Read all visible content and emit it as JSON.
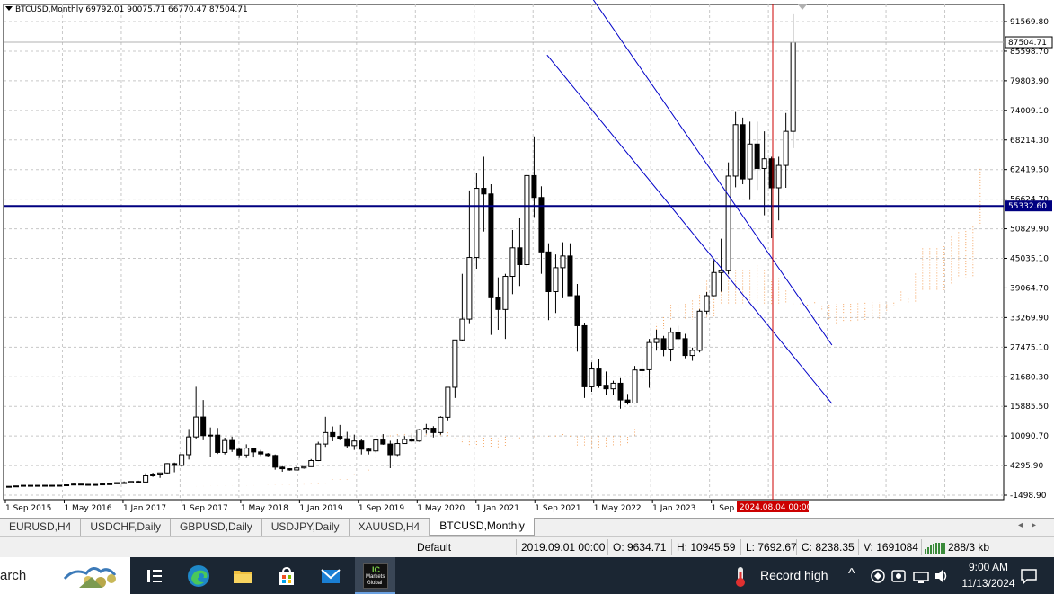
{
  "chart_header": "BTCUSD,Monthly  69792.01 90075.71 66770.47 87504.71",
  "price_labels": [
    "91569.80",
    "85598.70",
    "79803.90",
    "74009.10",
    "68214.30",
    "62419.50",
    "56624.70",
    "50829.90",
    "45035.10",
    "39064.70",
    "33269.90",
    "27475.10",
    "21680.30",
    "15885.50",
    "10090.70",
    "4295.90",
    "-1498.90"
  ],
  "current_price": "87504.71",
  "hline_price": "55332.60",
  "time_labels": [
    "1 Sep 2015",
    "1 May 2016",
    "1 Jan 2017",
    "1 Sep 2017",
    "1 May 2018",
    "1 Jan 2019",
    "1 Sep 2019",
    "1 May 2020",
    "1 Jan 2021",
    "1 Sep 2021",
    "1 May 2022",
    "1 Jan 2023",
    "1 Sep 2023"
  ],
  "crosshair_time": "2024.08.04 00:00",
  "colors": {
    "grid": "#c8c8c8",
    "hline": "#000080",
    "channel": "#0000c8",
    "cursor": "#cc0000",
    "cloud": "#f4a460",
    "price_box": "#000080"
  },
  "tabs": [
    {
      "label": "EURUSD,H4",
      "active": false
    },
    {
      "label": "USDCHF,Daily",
      "active": false
    },
    {
      "label": "GBPUSD,Daily",
      "active": false
    },
    {
      "label": "USDJPY,Daily",
      "active": false
    },
    {
      "label": "XAUUSD,H4",
      "active": false
    },
    {
      "label": "BTCUSD,Monthly",
      "active": true
    }
  ],
  "status": {
    "profile": "Default",
    "datetime": "2019.09.01 00:00",
    "open": "O: 9634.71",
    "high": "H: 10945.59",
    "low": "L: 7692.67",
    "close": "C: 8238.35",
    "volume": "V: 1691084",
    "traffic": "288/3 kb"
  },
  "taskbar": {
    "search_text": "arch",
    "weather": "Record high",
    "time": "9:00 AM",
    "date": "11/13/2024",
    "mt_label_1": "IC",
    "mt_label_2": "Markets",
    "mt_label_3": "Global"
  },
  "chart_data": {
    "type": "candlestick",
    "symbol": "BTCUSD",
    "timeframe": "Monthly",
    "ylim": [
      -1498.9,
      91569.8
    ],
    "start": "2015-09",
    "candles": [
      [
        230,
        240,
        220,
        236
      ],
      [
        236,
        330,
        232,
        315
      ],
      [
        315,
        470,
        300,
        430
      ],
      [
        430,
        470,
        350,
        430
      ],
      [
        430,
        460,
        360,
        416
      ],
      [
        416,
        440,
        400,
        437
      ],
      [
        437,
        460,
        370,
        420
      ],
      [
        420,
        450,
        410,
        446
      ],
      [
        446,
        580,
        440,
        530
      ],
      [
        530,
        780,
        520,
        672
      ],
      [
        672,
        700,
        600,
        620
      ],
      [
        620,
        630,
        540,
        575
      ],
      [
        575,
        620,
        560,
        610
      ],
      [
        610,
        760,
        600,
        700
      ],
      [
        700,
        750,
        690,
        740
      ],
      [
        740,
        980,
        730,
        965
      ],
      [
        965,
        1200,
        750,
        970
      ],
      [
        970,
        1200,
        930,
        1190
      ],
      [
        1190,
        1350,
        1000,
        1080
      ],
      [
        1080,
        2800,
        1070,
        2300
      ],
      [
        2300,
        2900,
        2100,
        2480
      ],
      [
        2480,
        2900,
        1900,
        2870
      ],
      [
        2870,
        4800,
        2700,
        4700
      ],
      [
        4700,
        4900,
        3000,
        4350
      ],
      [
        4350,
        6500,
        4100,
        6450
      ],
      [
        6450,
        11500,
        5500,
        9950
      ],
      [
        9950,
        19800,
        9500,
        13850
      ],
      [
        13850,
        17200,
        9300,
        10200
      ],
      [
        10200,
        11800,
        6000,
        10300
      ],
      [
        10300,
        11700,
        6600,
        6900
      ],
      [
        6900,
        9800,
        6500,
        9250
      ],
      [
        9250,
        10000,
        7000,
        7500
      ],
      [
        7500,
        7800,
        5800,
        6400
      ],
      [
        6400,
        8500,
        5800,
        7750
      ],
      [
        7750,
        7800,
        5900,
        7000
      ],
      [
        7000,
        7400,
        6200,
        6600
      ],
      [
        6600,
        6800,
        6100,
        6300
      ],
      [
        6300,
        6500,
        3500,
        4000
      ],
      [
        4000,
        4200,
        3100,
        3700
      ],
      [
        3700,
        3800,
        3300,
        3450
      ],
      [
        3450,
        4200,
        3400,
        3850
      ],
      [
        3850,
        4150,
        3700,
        4100
      ],
      [
        4100,
        5600,
        4050,
        5300
      ],
      [
        5300,
        9000,
        5200,
        8550
      ],
      [
        8550,
        13900,
        8000,
        10800
      ],
      [
        10800,
        12000,
        9100,
        10050
      ],
      [
        10050,
        12300,
        9300,
        9600
      ],
      [
        9600,
        10945,
        7692,
        8238
      ],
      [
        8238,
        10400,
        7400,
        9150
      ],
      [
        9150,
        9500,
        6500,
        7550
      ],
      [
        7550,
        7800,
        6500,
        7200
      ],
      [
        7200,
        9600,
        6900,
        9350
      ],
      [
        9350,
        10500,
        8400,
        8550
      ],
      [
        8550,
        9200,
        3800,
        6450
      ],
      [
        6450,
        9500,
        6200,
        8650
      ],
      [
        8650,
        10100,
        8600,
        9450
      ],
      [
        9450,
        10400,
        8900,
        9150
      ],
      [
        9150,
        11500,
        9000,
        11350
      ],
      [
        11350,
        12500,
        10600,
        11650
      ],
      [
        11650,
        12050,
        9850,
        10800
      ],
      [
        10800,
        14000,
        10400,
        13800
      ],
      [
        13800,
        19500,
        13200,
        19700
      ],
      [
        19700,
        29000,
        17600,
        29000
      ],
      [
        29000,
        42000,
        28700,
        33100
      ],
      [
        33100,
        58400,
        32300,
        45200
      ],
      [
        45200,
        61800,
        43000,
        58800
      ],
      [
        58800,
        65000,
        50300,
        57700
      ],
      [
        57700,
        59600,
        30000,
        37300
      ],
      [
        37300,
        41300,
        31000,
        35000
      ],
      [
        35000,
        42000,
        29200,
        41500
      ],
      [
        41500,
        50600,
        38000,
        47100
      ],
      [
        47100,
        52900,
        39600,
        43800
      ],
      [
        43800,
        61500,
        43300,
        61300
      ],
      [
        61300,
        69000,
        53000,
        57000
      ],
      [
        57000,
        59200,
        42000,
        46300
      ],
      [
        46300,
        48000,
        32900,
        38500
      ],
      [
        38500,
        45800,
        34300,
        43200
      ],
      [
        43200,
        48200,
        37200,
        45500
      ],
      [
        45500,
        48000,
        37700,
        37700
      ],
      [
        37700,
        40000,
        26700,
        31800
      ],
      [
        31800,
        32400,
        17600,
        19800
      ],
      [
        19800,
        24600,
        18800,
        23300
      ],
      [
        23300,
        25200,
        19600,
        20100
      ],
      [
        20100,
        22800,
        18200,
        19400
      ],
      [
        19400,
        21000,
        18200,
        20500
      ],
      [
        20500,
        21500,
        15500,
        17200
      ],
      [
        17200,
        18400,
        16300,
        16600
      ],
      [
        16600,
        23900,
        16500,
        23100
      ],
      [
        23100,
        25300,
        21400,
        23150
      ],
      [
        23150,
        29200,
        19600,
        28500
      ],
      [
        28500,
        31000,
        26900,
        29250
      ],
      [
        29250,
        29800,
        25800,
        27200
      ],
      [
        27200,
        31400,
        24800,
        30500
      ],
      [
        30500,
        31800,
        28900,
        29250
      ],
      [
        29250,
        30200,
        25400,
        25950
      ],
      [
        25950,
        27500,
        24900,
        26950
      ],
      [
        26950,
        35000,
        26550,
        34650
      ],
      [
        34650,
        38400,
        34100,
        37700
      ],
      [
        37700,
        44700,
        37600,
        42250
      ],
      [
        42250,
        48900,
        38500,
        42600
      ],
      [
        42600,
        63900,
        41900,
        61200
      ],
      [
        61200,
        73800,
        59000,
        71300
      ],
      [
        71300,
        72700,
        59600,
        60650
      ],
      [
        60650,
        71900,
        56500,
        67500
      ],
      [
        67500,
        71900,
        58500,
        62700
      ],
      [
        62700,
        70000,
        53500,
        64600
      ],
      [
        64600,
        65000,
        49000,
        58900
      ],
      [
        58900,
        65000,
        52500,
        63300
      ],
      [
        63300,
        73600,
        58900,
        70000
      ],
      [
        70000,
        93000,
        66700,
        87500
      ]
    ],
    "channel": {
      "upper": [
        [
          2021.9,
          109000
        ],
        [
          2025.2,
          28000
        ]
      ],
      "lower": [
        [
          2021.9,
          85000
        ],
        [
          2025.2,
          16500
        ]
      ]
    }
  }
}
